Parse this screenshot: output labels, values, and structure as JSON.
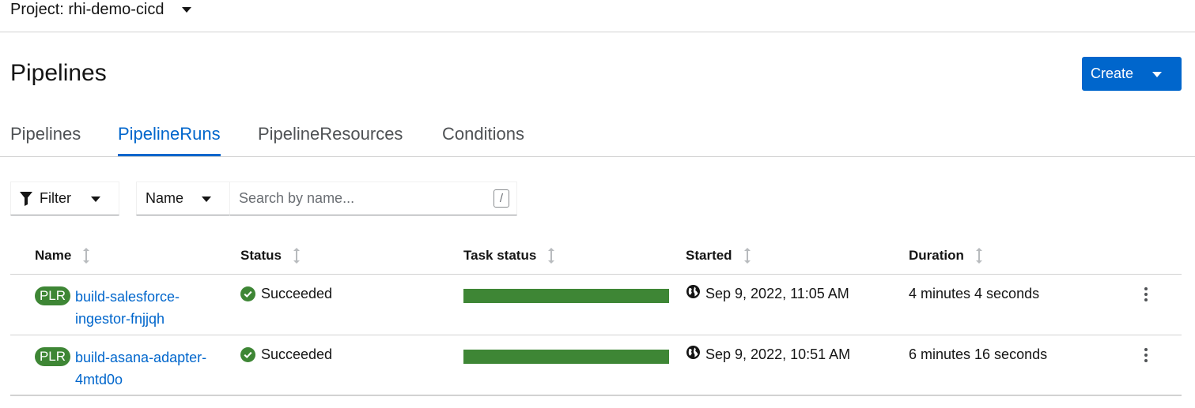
{
  "project": {
    "label": "Project: rhi-demo-cicd"
  },
  "page": {
    "title": "Pipelines"
  },
  "actions": {
    "create_label": "Create"
  },
  "tabs": [
    {
      "label": "Pipelines",
      "active": false
    },
    {
      "label": "PipelineRuns",
      "active": true
    },
    {
      "label": "PipelineResources",
      "active": false
    },
    {
      "label": "Conditions",
      "active": false
    }
  ],
  "toolbar": {
    "filter_label": "Filter",
    "name_select_label": "Name",
    "search_placeholder": "Search by name...",
    "search_shortcut": "/"
  },
  "table": {
    "columns": [
      "Name",
      "Status",
      "Task status",
      "Started",
      "Duration"
    ],
    "rows": [
      {
        "badge": "PLR",
        "name": "build-salesforce-ingestor-fnjjqh",
        "status": "Succeeded",
        "task_progress": 1.0,
        "started": "Sep 9, 2022, 11:05 AM",
        "duration": "4 minutes 4 seconds"
      },
      {
        "badge": "PLR",
        "name": "build-asana-adapter-4mtd0o",
        "status": "Succeeded",
        "task_progress": 1.0,
        "started": "Sep 9, 2022, 10:51 AM",
        "duration": "6 minutes 16 seconds"
      }
    ]
  },
  "colors": {
    "primary": "#0066cc",
    "success": "#3e8635",
    "border": "#d2d2d2"
  },
  "icons": {
    "filter": "funnel-icon",
    "sort": "sort-icon",
    "status": "check-circle-icon",
    "started": "globe-icon",
    "row_actions": "kebab-icon"
  }
}
